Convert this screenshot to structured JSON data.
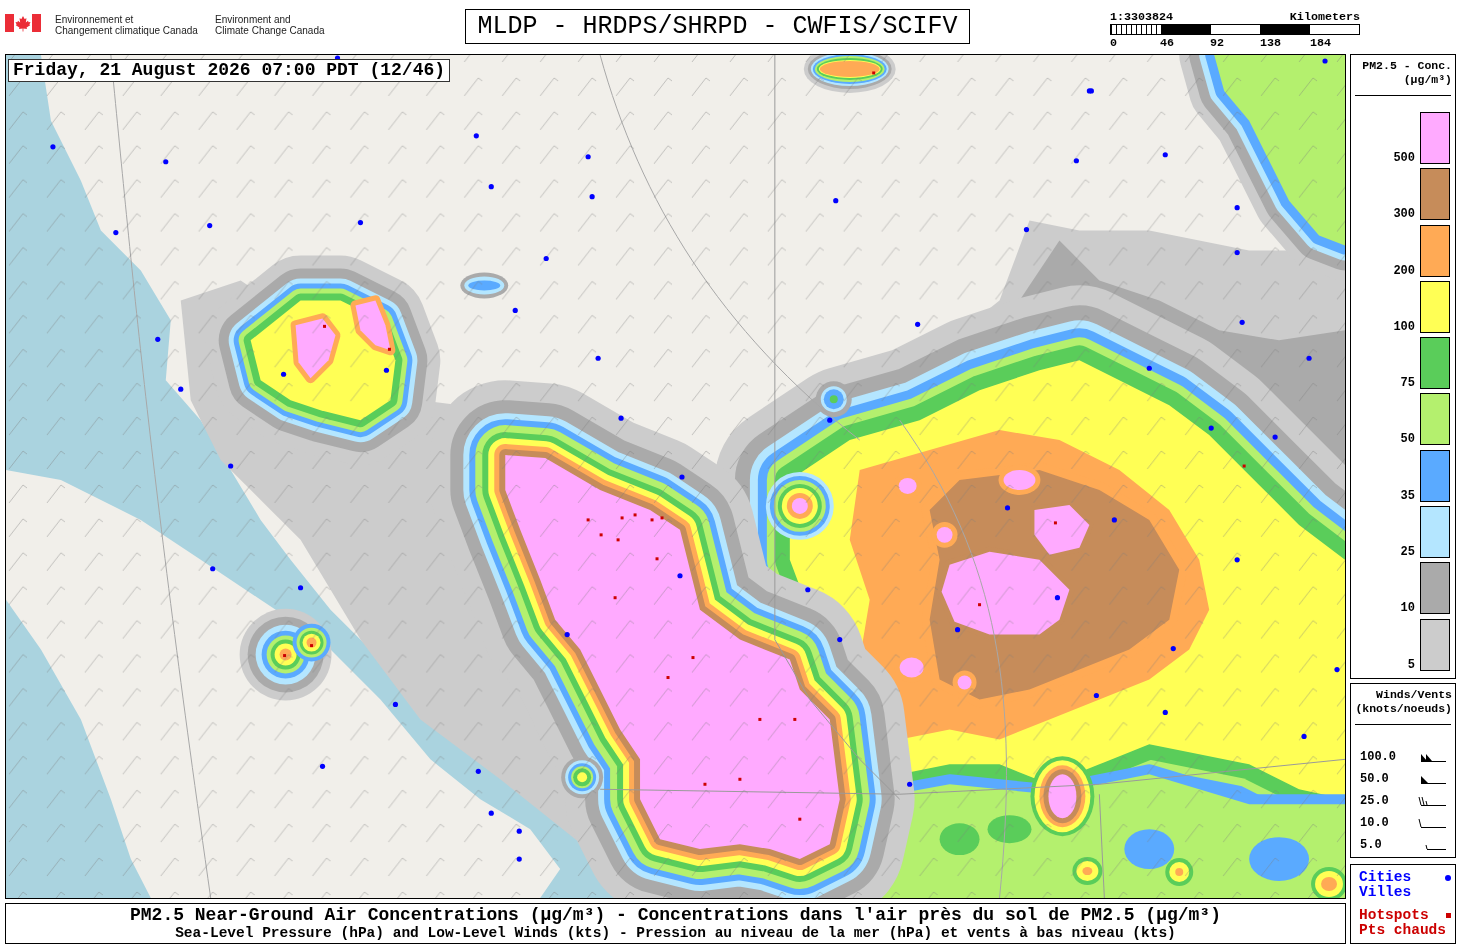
{
  "header": {
    "agency_fr": [
      "Environnement et",
      "Changement climatique Canada"
    ],
    "agency_en": [
      "Environment and",
      "Climate Change Canada"
    ],
    "title": "MLDP - HRDPS/SHRPD - CWFIS/SCIFV"
  },
  "scale": {
    "ratio": "1:3303824",
    "unit": "Kilometers",
    "ticks": [
      "0",
      "46",
      "92",
      "138",
      "184"
    ]
  },
  "map": {
    "timestamp": "Friday, 21 August 2026 07:00 PDT (12/46)"
  },
  "legend": {
    "concentration": {
      "title": "PM2.5 - Conc.",
      "units": "(µg/m³)",
      "levels": [
        {
          "label": "500",
          "color": "#ffaaff"
        },
        {
          "label": "300",
          "color": "#c68c5a"
        },
        {
          "label": "200",
          "color": "#ffaa55"
        },
        {
          "label": "100",
          "color": "#ffff55"
        },
        {
          "label": "75",
          "color": "#5acd5a"
        },
        {
          "label": "50",
          "color": "#b4f06e"
        },
        {
          "label": "35",
          "color": "#5aaaff"
        },
        {
          "label": "25",
          "color": "#b4e6ff"
        },
        {
          "label": "10",
          "color": "#aaaaaa"
        },
        {
          "label": "5",
          "color": "#cccccc"
        }
      ]
    },
    "winds": {
      "title": "Winds/Vents",
      "units": "(knots/noeuds)",
      "barbs": [
        {
          "label": "100.0",
          "kind": "double-pennant"
        },
        {
          "label": "50.0",
          "kind": "pennant"
        },
        {
          "label": "25.0",
          "kind": "barbs"
        },
        {
          "label": "10.0",
          "kind": "barb"
        },
        {
          "label": "5.0",
          "kind": "half-barb"
        }
      ]
    },
    "symbols": [
      {
        "labels": [
          "Cities",
          "Villes"
        ],
        "kind": "dot",
        "color": "#0000ff"
      },
      {
        "labels": [
          "Hotspots",
          "Pts chauds"
        ],
        "kind": "square",
        "color": "#cc0000"
      }
    ]
  },
  "caption": {
    "title": "PM2.5 Near-Ground Air Concentrations (µg/m³) - Concentrations dans l'air près du sol de PM2.5 (µg/m³)",
    "subtitle": "Sea-Level Pressure (hPa) and Low-Level Winds (kts) - Pression au niveau de la mer (hPa) et vents à bas niveau (kts)"
  }
}
